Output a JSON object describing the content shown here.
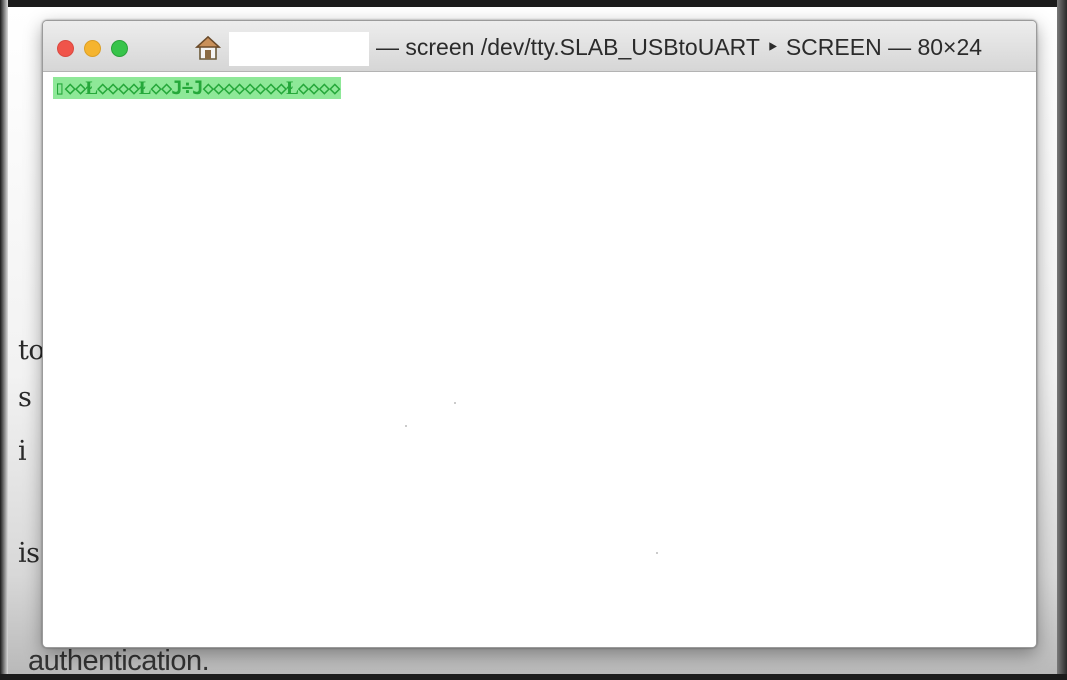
{
  "background_page": {
    "fragments": [
      "tor",
      "s",
      "i",
      "is",
      "authentication."
    ]
  },
  "window": {
    "title_prefix": "— screen /dev/tty.SLAB_USBtoUART ‣ SCREEN — 80×24",
    "icon": "home-icon",
    "controls": {
      "close": "close",
      "minimize": "minimize",
      "zoom": "zoom"
    },
    "colors": {
      "close": "#f0544a",
      "minimize": "#f5b42f",
      "zoom": "#37c44a",
      "output_text": "#25a83a",
      "output_highlight": "#8ee898"
    }
  },
  "terminal": {
    "output_line": "▯◇◇Ɫ◇◇◇◇Ɫ◇◇J÷J◇◇◇◇◇◇◇◇Ɫ◇◇◇◇"
  }
}
